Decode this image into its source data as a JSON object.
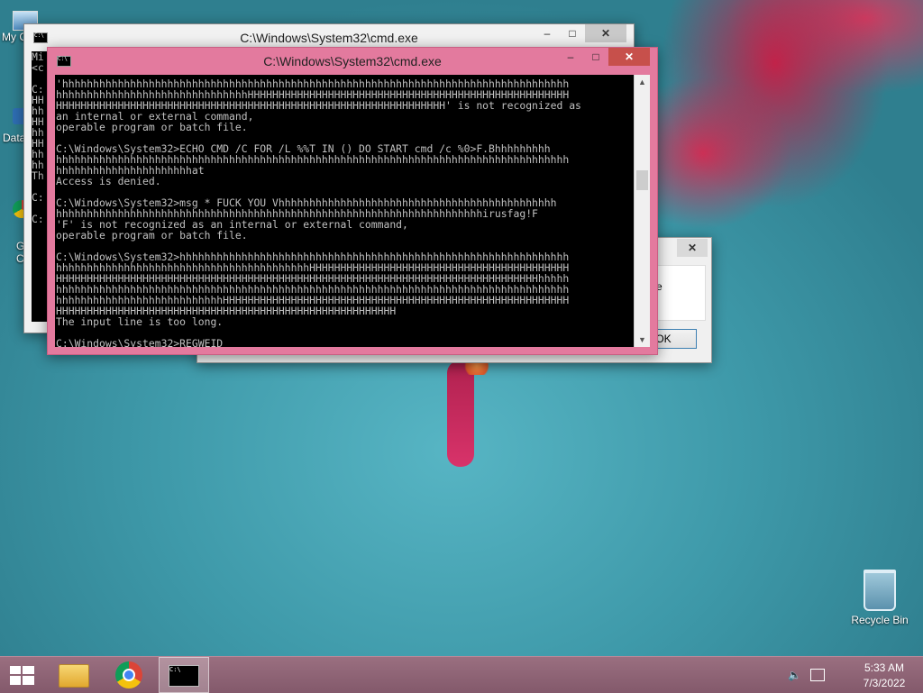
{
  "desktop": {
    "icons": [
      {
        "label": "Recycle Bin"
      }
    ],
    "partial_icon_labels": [
      "My C",
      "Data",
      "G",
      "C"
    ]
  },
  "windows": {
    "back": {
      "title": "C:\\Windows\\System32\\cmd.exe",
      "lines": [
        "Mi",
        "<c",
        "",
        "C:",
        "HH",
        "hh",
        "HH",
        "hh",
        "HH",
        "hh",
        "hh",
        "Th",
        "",
        "C:",
        "",
        "C:"
      ]
    },
    "front": {
      "title": "C:\\Windows\\System32\\cmd.exe",
      "lines": [
        "'hhhhhhhhhhhhhhhhhhhhhhhhhhhhhhhhhhhhhhhhhhhhhhhhhhhhhhhhhhhhhhhhhhhhhhhhhhhhhhhhhh",
        "hhhhhhhhhhhhhhhhhhhhhhhhhhhhhhhHHHHHHHHHHHHHHHHHHHHHHHHHHHHHHHHHHHHHHHHHHHHHHHHHHHH",
        "HHHHHHHHHHHHHHHHHHHHHHHHHHHHHHHHHHHHHHHHHHHHHHHHHHHHHHHHHHHHHHH' is not recognized as",
        "an internal or external command,",
        "operable program or batch file.",
        "",
        "C:\\Windows\\System32>ECHO CMD /C FOR /L %%T IN () DO START cmd /c %0>F.Bhhhhhhhhh",
        "hhhhhhhhhhhhhhhhhhhhhhhhhhhhhhhhhhhhhhhhhhhhhhhhhhhhhhhhhhhhhhhhhhhhhhhhhhhhhhhhhhh",
        "hhhhhhhhhhhhhhhhhhhhhhat",
        "Access is denied.",
        "",
        "C:\\Windows\\System32>msg * FUCK YOU Vhhhhhhhhhhhhhhhhhhhhhhhhhhhhhhhhhhhhhhhhhhhhh",
        "hhhhhhhhhhhhhhhhhhhhhhhhhhhhhhhhhhhhhhhhhhhhhhhhhhhhhhhhhhhhhhhhhhhhhirusfag!F",
        "'F' is not recognized as an internal or external command,",
        "operable program or batch file.",
        "",
        "C:\\Windows\\System32>hhhhhhhhhhhhhhhhhhhhhhhhhhhhhhhhhhhhhhhhhhhhhhhhhhhhhhhhhhhhhhh",
        "hhhhhhhhhhhhhhhhhhhhhhhhhhhhhhhhhhhhhhhhhHHHHHHHHHHHHHHHHHHHHHHHHHHHHHHHHHHHHHHHHHH",
        "HHHHHHHHHHHHHHHHHHHHHHHHHHHHHHHHHHHHHHHHHHHHHHHHHHHHHHHHHHHHHHHHHHHHHHHHHHHHHHhhhhh",
        "hhhhhhhhhhhhhhhhhhhhhhhhhhhhhhhhhhhhhhhhhhhhhhhhhhhhhhhhhhhhhhhhhhhhhhhhhhhhhhhhhhh",
        "hhhhhhhhhhhhhhhhhhhhhhhhhhhHHHHHHHHHHHHHHHHHHHHHHHHHHHHHHHHHHHHHHHHHHHHHHHHHHHHHHHH",
        "HHHHHHHHHHHHHHHHHHHHHHHHHHHHHHHHHHHHHHHHHHHHHHHHHHHHHHH",
        "The input line is too long.",
        "",
        "C:\\Windows\\System32>REGWEID_"
      ]
    },
    "dialog": {
      "partial_text": "e",
      "ok_label": "OK"
    }
  },
  "window_controls": {
    "minimize": "–",
    "maximize": "□",
    "close": "✕"
  },
  "taskbar": {
    "start_icon": "windows-logo-icon",
    "pinned": [
      "file-explorer-icon",
      "chrome-icon",
      "cmd-icon"
    ],
    "tray": {
      "time": "5:33 AM",
      "date": "7/3/2022"
    }
  },
  "colors": {
    "front_frame": "#e37a9e",
    "back_frame": "#f1f1f1",
    "taskbar": "#8e6476",
    "close_button": "#c7504b",
    "console_text": "#c0c0c0"
  }
}
